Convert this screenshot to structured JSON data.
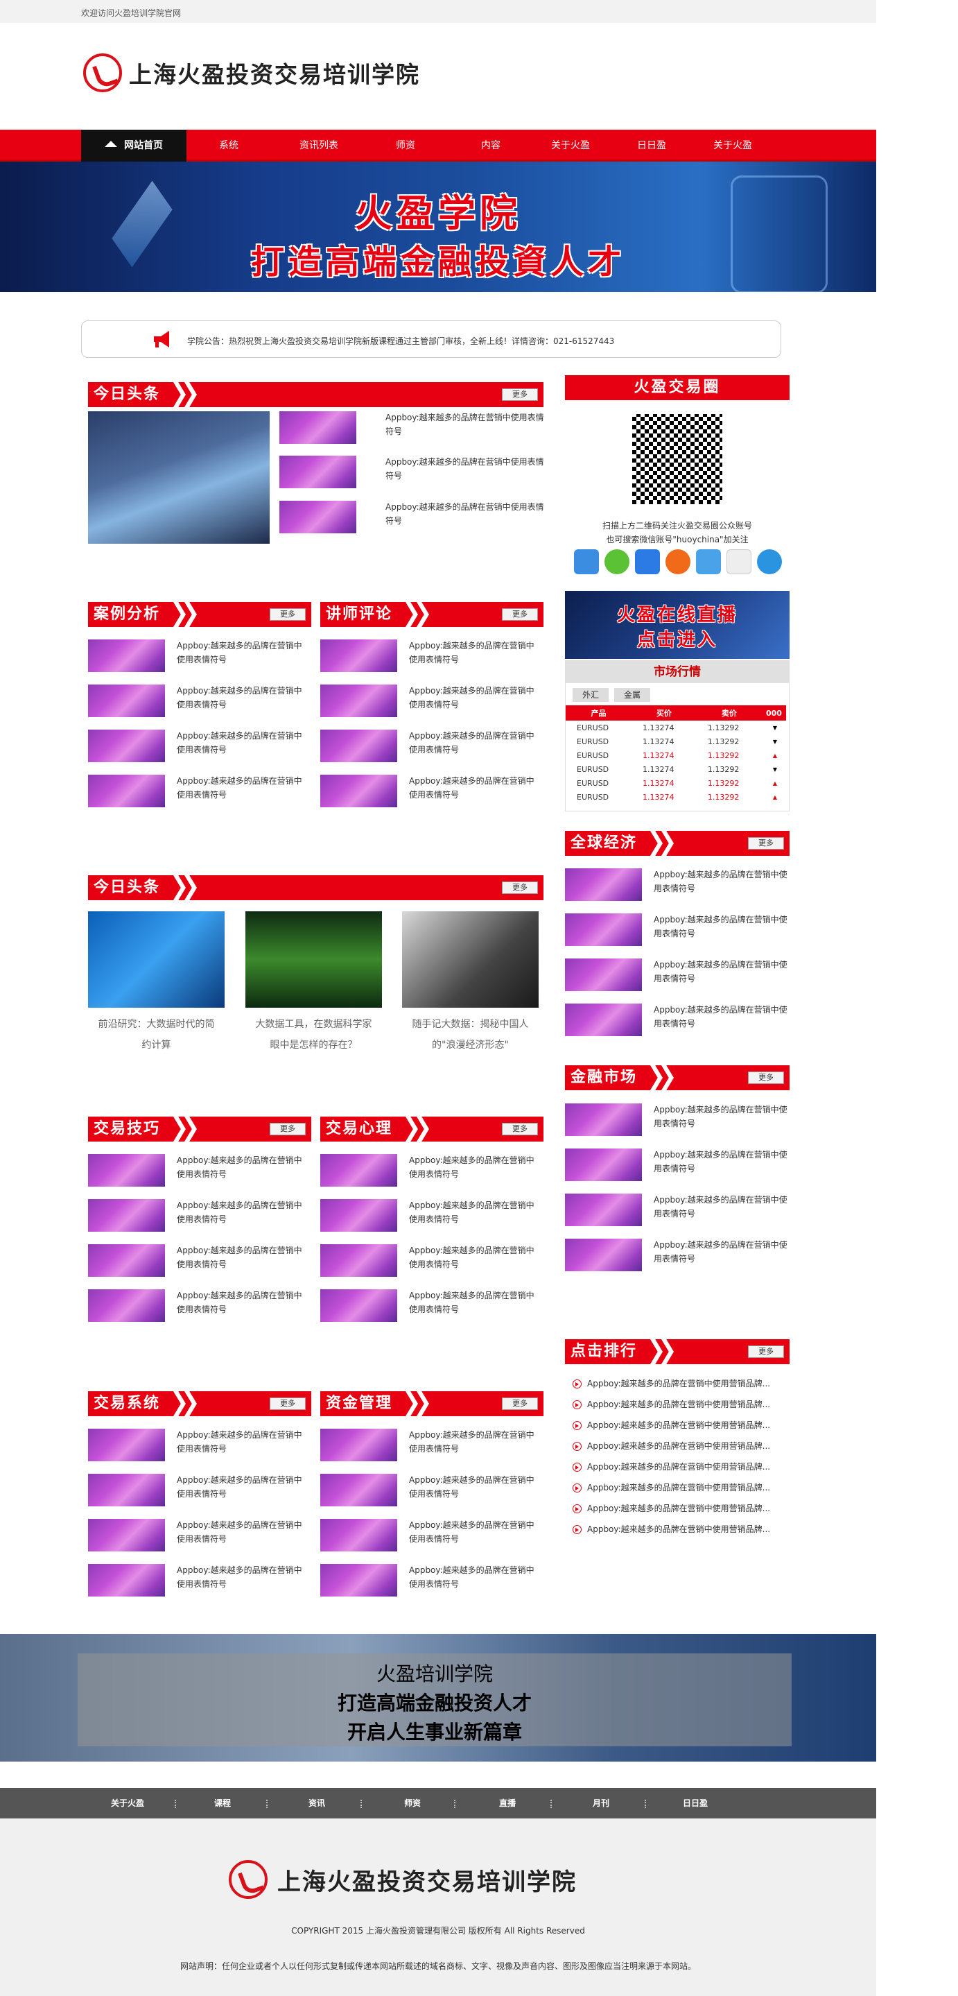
{
  "topbar": {
    "welcome": "欢迎访问火盈培训学院官网"
  },
  "brand": {
    "name": "上海火盈投资交易培训学院",
    "accent": "#e60012"
  },
  "nav": {
    "home": "网站首页",
    "items": [
      "系统",
      "资讯列表",
      "师资",
      "内容",
      "关于火盈",
      "日日盈",
      "关于火盈"
    ]
  },
  "banner": {
    "line1": "火盈学院",
    "line2": "打造高端金融投資人才"
  },
  "notice": {
    "text": "学院公告：热烈祝贺上海火盈投资交易培训学院新版课程通过主管部门审核，全新上线！详情咨询：021-61527443"
  },
  "more": "更多",
  "item_text": "Appboy:越来越多的品牌在营销中使用表情符号",
  "sections": {
    "today1": {
      "title": "今日头条"
    },
    "case": {
      "title": "案例分析"
    },
    "lecturer": {
      "title": "讲师评论"
    },
    "today2": {
      "title": "今日头条",
      "cards": [
        {
          "line1": "前沿研究：大数据时代的简",
          "line2": "约计算"
        },
        {
          "line1": "大数据工具，在数据科学家",
          "line2": "眼中是怎样的存在？"
        },
        {
          "line1": "随手记大数据：揭秘中国人",
          "line2": "的\"浪漫经济形态\""
        }
      ]
    },
    "skills": {
      "title": "交易技巧"
    },
    "psych": {
      "title": "交易心理"
    },
    "system": {
      "title": "交易系统"
    },
    "money": {
      "title": "资金管理"
    },
    "global": {
      "title": "全球经济"
    },
    "finance": {
      "title": "金融市场"
    },
    "ranking": {
      "title": "点击排行",
      "item": "Appboy:越来越多的品牌在营销中使用营销品牌..."
    }
  },
  "circle": {
    "title": "火盈交易圈",
    "line1": "扫描上方二维码关注火盈交易圈公众账号",
    "line2": "也可搜索微信账号\"huoychina\"加关注"
  },
  "social_icons": [
    "add-share-icon",
    "wechat-icon",
    "star-icon",
    "weibo-icon",
    "pengyou-icon",
    "copy-icon",
    "qq-icon"
  ],
  "live": {
    "line1": "火盈在线直播",
    "line2": "点击进入"
  },
  "market": {
    "title": "市场行情",
    "tabs": [
      "外汇",
      "金属"
    ],
    "headers": [
      "产品",
      "买价",
      "卖价",
      "000"
    ],
    "rows": [
      {
        "p": "EURUSD",
        "b": "1.13274",
        "s": "1.13292",
        "dir": "down"
      },
      {
        "p": "EURUSD",
        "b": "1.13274",
        "s": "1.13292",
        "dir": "down"
      },
      {
        "p": "EURUSD",
        "b": "1.13274",
        "s": "1.13292",
        "dir": "up"
      },
      {
        "p": "EURUSD",
        "b": "1.13274",
        "s": "1.13292",
        "dir": "down"
      },
      {
        "p": "EURUSD",
        "b": "1.13274",
        "s": "1.13292",
        "dir": "up"
      },
      {
        "p": "EURUSD",
        "b": "1.13274",
        "s": "1.13292",
        "dir": "up"
      }
    ]
  },
  "bottom_banner": {
    "line1": "火盈培训学院",
    "line2": "打造高端金融投资人才",
    "line3": "开启人生事业新篇章"
  },
  "footer_nav": [
    "关于火盈",
    "课程",
    "资讯",
    "师资",
    "直播",
    "月刊",
    "日日盈"
  ],
  "footer": {
    "copyright": "COPYRIGHT 2015 上海火盈投资管理有限公司 版权所有 All Rights Reserved",
    "declaration": "网站声明：任何企业或者个人以任何形式复制或传递本网站所载述的域名商标、文字、视像及声音内容、图形及图像应当注明来源于本网站。"
  }
}
